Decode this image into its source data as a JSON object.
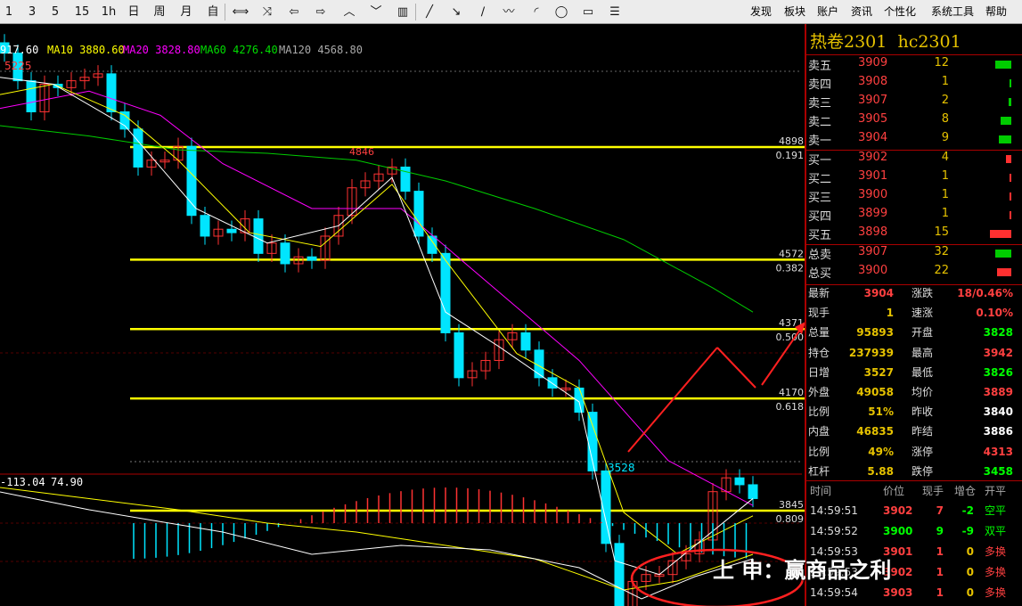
{
  "toolbar": {
    "periods": [
      "1",
      "3",
      "5",
      "15",
      "1h",
      "日",
      "周",
      "月",
      "自"
    ],
    "icons": [
      "zoom-icon",
      "cross-icon",
      "arrow-left-icon",
      "arrow-right-icon",
      "arrow-up-icon",
      "arrow-down-icon",
      "bar-icon",
      "line-draw-icon",
      "ray-icon",
      "wave-icon",
      "fan-icon",
      "ellipse-icon",
      "rect-icon",
      "text-icon"
    ],
    "menus": [
      "发现",
      "板块",
      "账户",
      "资讯",
      "个性化",
      "系统工具",
      "帮助"
    ]
  },
  "ma_legend": {
    "ma5": "917.60",
    "ma10_label": "MA10",
    "ma10": "3880.60",
    "ma20_label": "MA20",
    "ma20": "3828.80",
    "ma60_label": "MA60",
    "ma60": "4276.40",
    "ma120_label": "MA120",
    "ma120": "4568.80"
  },
  "macd_header": {
    "v1": "-113.04",
    "v2": "74.90"
  },
  "chart_annotations": {
    "high_left": "5225",
    "peak_mid": "4846",
    "low": "3528"
  },
  "fib_levels": [
    {
      "price": "4898",
      "ratio": "0.191"
    },
    {
      "price": "4572",
      "ratio": "0.382"
    },
    {
      "price": "4371",
      "ratio": "0.500"
    },
    {
      "price": "4170",
      "ratio": "0.618"
    },
    {
      "price": "3845",
      "ratio": "0.809"
    }
  ],
  "colors": {
    "up": "#ff3232",
    "down": "#00e5ff",
    "fib": "#ffff00",
    "ma5": "#ffffff",
    "ma10": "#ffff00",
    "ma20": "#ff00ff",
    "ma60": "#00cc00",
    "ma120": "#aaaaaa"
  },
  "contract": {
    "name": "热卷2301",
    "code": "hc2301"
  },
  "orderbook": {
    "asks": [
      {
        "label": "卖五",
        "price": "3909",
        "vol": "12"
      },
      {
        "label": "卖四",
        "price": "3908",
        "vol": "1"
      },
      {
        "label": "卖三",
        "price": "3907",
        "vol": "2"
      },
      {
        "label": "卖二",
        "price": "3905",
        "vol": "8"
      },
      {
        "label": "卖一",
        "price": "3904",
        "vol": "9"
      }
    ],
    "bids": [
      {
        "label": "买一",
        "price": "3902",
        "vol": "4"
      },
      {
        "label": "买二",
        "price": "3901",
        "vol": "1"
      },
      {
        "label": "买三",
        "price": "3900",
        "vol": "1"
      },
      {
        "label": "买四",
        "price": "3899",
        "vol": "1"
      },
      {
        "label": "买五",
        "price": "3898",
        "vol": "15"
      }
    ],
    "totals": [
      {
        "label": "总卖",
        "price": "3907",
        "vol": "32"
      },
      {
        "label": "总买",
        "price": "3900",
        "vol": "22"
      }
    ]
  },
  "stats_left": [
    {
      "k": "最新",
      "v": "3904"
    },
    {
      "k": "现手",
      "v": "1"
    },
    {
      "k": "总量",
      "v": "95893"
    },
    {
      "k": "持仓",
      "v": "237939"
    },
    {
      "k": "日增",
      "v": "3527"
    },
    {
      "k": "外盘",
      "v": "49058"
    },
    {
      "k": "比例",
      "v": "51%"
    },
    {
      "k": "内盘",
      "v": "46835"
    },
    {
      "k": "比例",
      "v": "49%"
    },
    {
      "k": "杠杆",
      "v": "5.88"
    }
  ],
  "stats_right": [
    {
      "k": "涨跌",
      "v": "18/0.46%"
    },
    {
      "k": "速涨",
      "v": "0.10%"
    },
    {
      "k": "开盘",
      "v": "3828"
    },
    {
      "k": "最高",
      "v": "3942"
    },
    {
      "k": "最低",
      "v": "3826"
    },
    {
      "k": "均价",
      "v": "3889"
    },
    {
      "k": "昨收",
      "v": "3840"
    },
    {
      "k": "昨结",
      "v": "3886"
    },
    {
      "k": "涨停",
      "v": "4313"
    },
    {
      "k": "跌停",
      "v": "3458"
    }
  ],
  "ticks_header": {
    "time": "时间",
    "price": "价位",
    "qty": "现手",
    "oi": "增仓",
    "type": "开平"
  },
  "ticks": [
    {
      "time": "14:59:51",
      "price": "3902",
      "qty": "7",
      "oi": "-2",
      "type": "空平"
    },
    {
      "time": "14:59:52",
      "price": "3900",
      "qty": "9",
      "oi": "-9",
      "type": "双平"
    },
    {
      "time": "14:59:53",
      "price": "3901",
      "qty": "1",
      "oi": "0",
      "type": "多换"
    },
    {
      "time": "14:59:53",
      "price": "3902",
      "qty": "1",
      "oi": "0",
      "type": "多换"
    },
    {
      "time": "14:59:54",
      "price": "3903",
      "qty": "1",
      "oi": "0",
      "type": "多换"
    }
  ],
  "watermark": "上 申：赢商品之利"
}
